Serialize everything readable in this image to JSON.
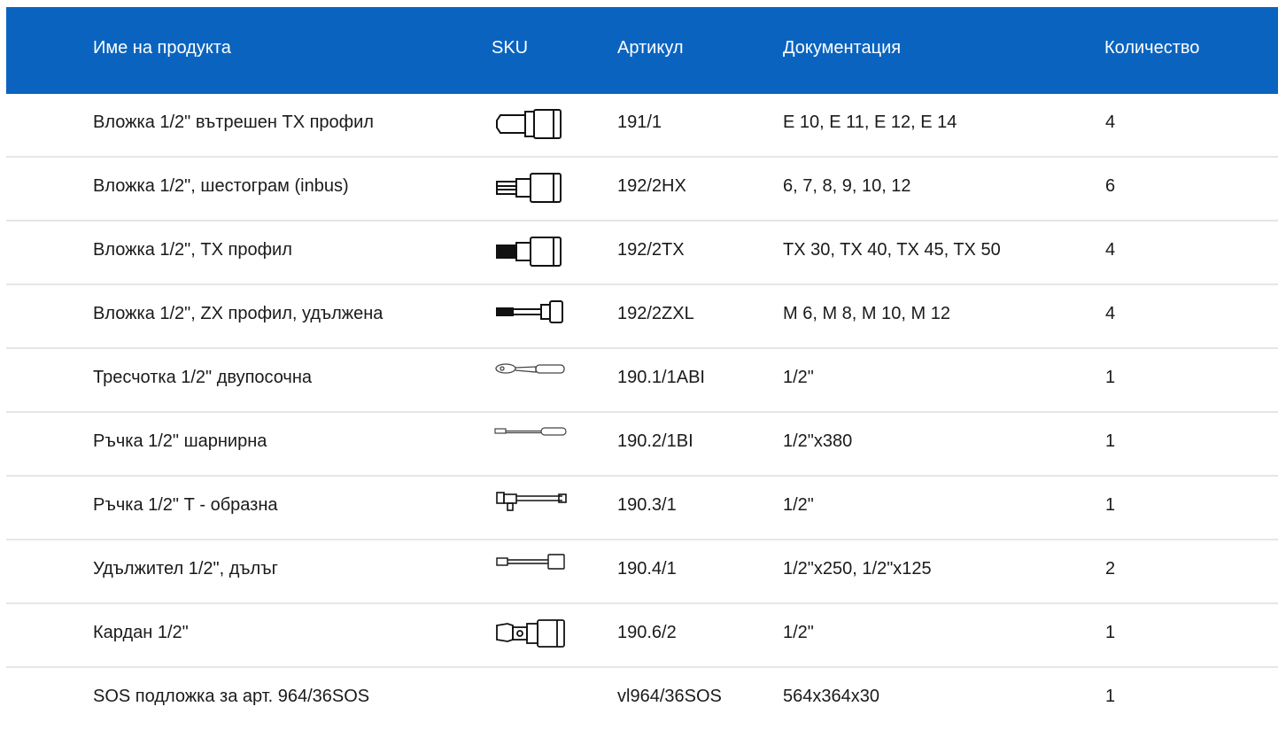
{
  "colors": {
    "header_bg": "#0a64bf",
    "header_text": "#ffffff",
    "divider": "#e6e6e6"
  },
  "header": {
    "name": "Име на продукта",
    "sku": "SKU",
    "article": "Артикул",
    "documentation": "Документация",
    "quantity": "Количество"
  },
  "rows": [
    {
      "name": "Вложка 1/2\" вътрешен TX профил",
      "icon": "socket-tx-internal-icon",
      "article": "191/1",
      "documentation": "E 10, E 11, E 12, E 14",
      "quantity": "4"
    },
    {
      "name": "Вложка 1/2\", шестограм (inbus)",
      "icon": "socket-hex-bit-icon",
      "article": "192/2HX",
      "documentation": "6, 7, 8, 9, 10, 12",
      "quantity": "6"
    },
    {
      "name": "Вложка 1/2\", TX профил",
      "icon": "socket-tx-bit-icon",
      "article": "192/2TX",
      "documentation": "TX 30, TX 40, TX 45, TX 50",
      "quantity": "4"
    },
    {
      "name": "Вложка 1/2\", ZX профил, удължена",
      "icon": "socket-zx-long-icon",
      "article": "192/2ZXL",
      "documentation": "M 6, M 8, M 10, M 12",
      "quantity": "4"
    },
    {
      "name": "Тресчотка 1/2\" двупосочна",
      "icon": "ratchet-icon",
      "article": "190.1/1ABI",
      "documentation": "1/2\"",
      "quantity": "1"
    },
    {
      "name": "Ръчка 1/2\" шарнирна",
      "icon": "hinged-handle-icon",
      "article": "190.2/1BI",
      "documentation": "1/2\"x380",
      "quantity": "1"
    },
    {
      "name": "Ръчка 1/2\" Т - образна",
      "icon": "t-handle-icon",
      "article": "190.3/1",
      "documentation": "1/2\"",
      "quantity": "1"
    },
    {
      "name": "Удължител 1/2\", дълъг",
      "icon": "extension-bar-icon",
      "article": "190.4/1",
      "documentation": "1/2\"x250, 1/2\"x125",
      "quantity": "2"
    },
    {
      "name": "Кардан 1/2\"",
      "icon": "universal-joint-icon",
      "article": "190.6/2",
      "documentation": "1/2\"",
      "quantity": "1"
    },
    {
      "name": "SOS подложка за арт. 964/36SOS",
      "icon": "",
      "article": "vl964/36SOS",
      "documentation": "564x364x30",
      "quantity": "1"
    }
  ]
}
